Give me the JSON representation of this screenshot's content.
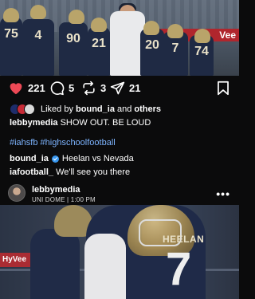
{
  "top_photo": {
    "ad_text": "Vee",
    "jersey_numbers": [
      "75",
      "4",
      "90",
      "21",
      "20",
      "7",
      "74"
    ]
  },
  "actions": {
    "likes": "221",
    "comments": "5",
    "reposts": "3",
    "shares": "21"
  },
  "caption": {
    "liked_by_prefix": "Liked by",
    "liked_by_user": "bound_ia",
    "liked_by_joiner": "and",
    "liked_by_others": "others",
    "author": "lebbymedia",
    "text": "SHOW OUT. BE LOUD",
    "hashtags": "#iahsfb #highschoolfootball",
    "comments": [
      {
        "user": "bound_ia",
        "verified": true,
        "text": "Heelan vs Nevada"
      },
      {
        "user": "iafootball_",
        "verified": false,
        "text": "We'll see you there"
      }
    ]
  },
  "owner": {
    "name": "lebbymedia",
    "location": "UNI DOME | 1:00 PM",
    "more": "•••"
  },
  "bottom_photo": {
    "board_text": "HyVee",
    "jersey_name": "HEELAN",
    "jersey_number": "7"
  },
  "colors": {
    "background": "#0b0b0c",
    "like_heart": "#ed4956",
    "hashtag": "#7db4ff",
    "verified": "#3897f0"
  }
}
